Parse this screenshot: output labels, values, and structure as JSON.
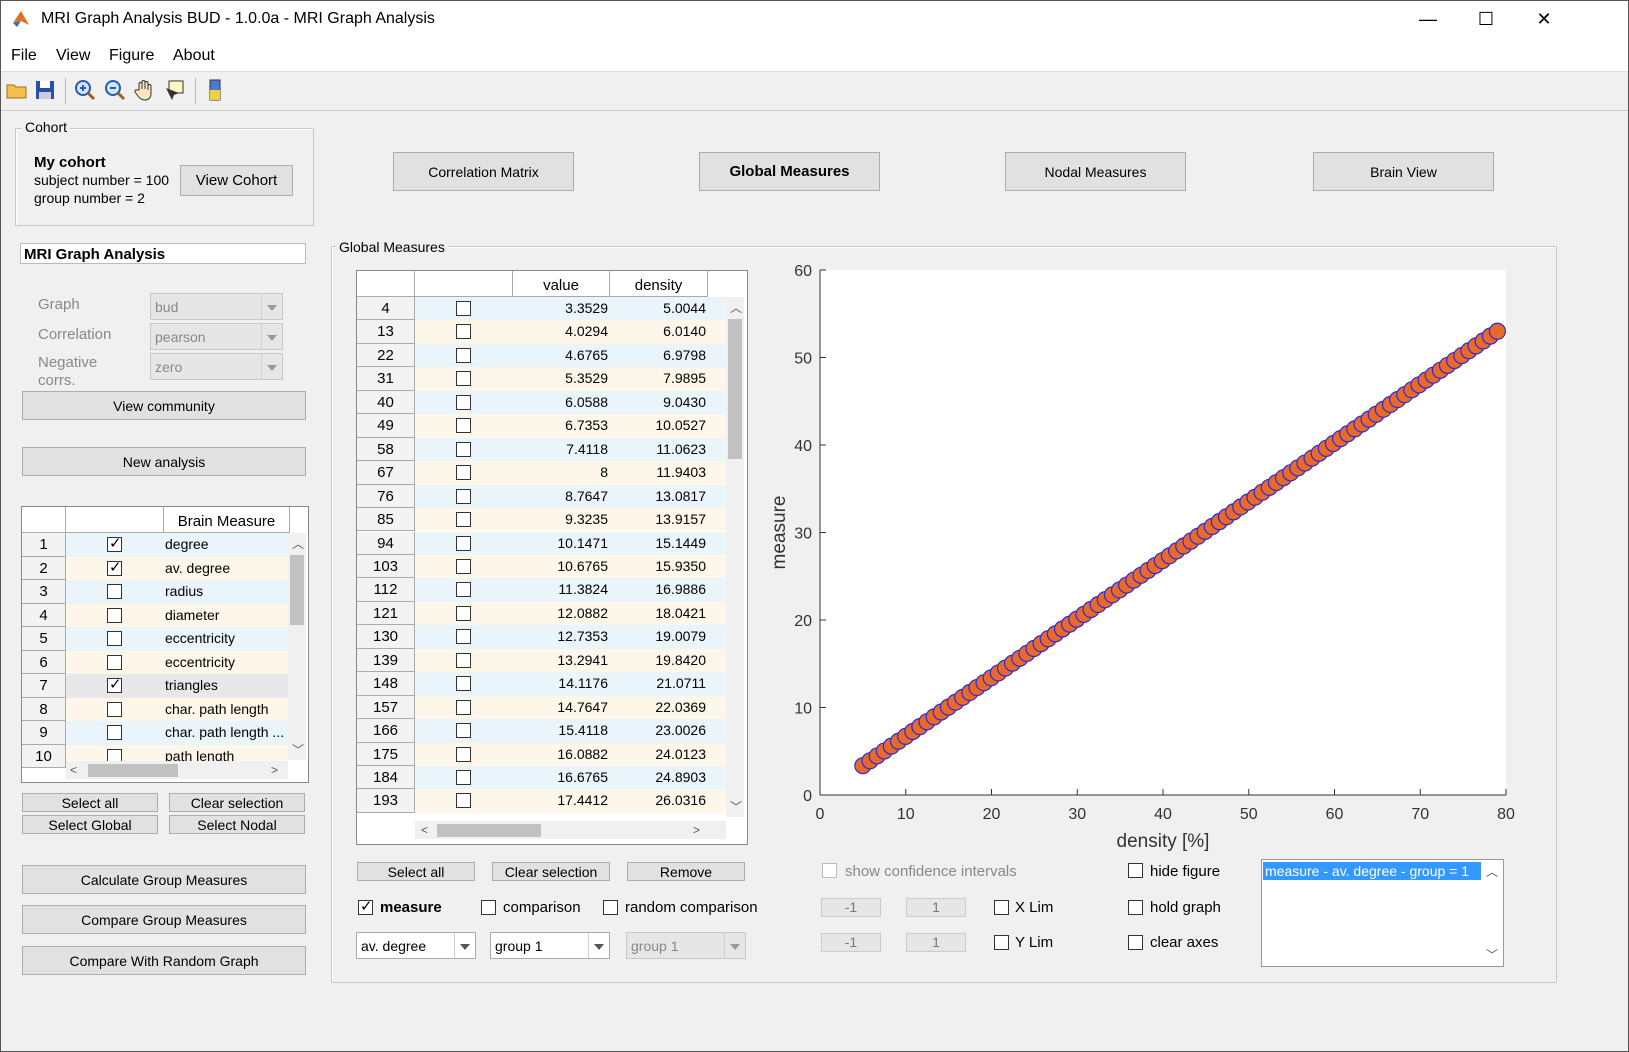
{
  "window": {
    "title": "MRI Graph Analysis BUD - 1.0.0a - MRI Graph Analysis",
    "minimize": "—",
    "maximize": "☐",
    "close": "✕"
  },
  "menu": [
    "File",
    "View",
    "Figure",
    "About"
  ],
  "toolbar": [
    "open-icon",
    "save-icon",
    "zoom-in-icon",
    "zoom-out-icon",
    "pan-icon",
    "data-cursor-icon",
    "colorbar-icon"
  ],
  "cohort": {
    "panel_title": "Cohort",
    "name": "My cohort",
    "subject_number": "subject number = 100",
    "group_number": "group number = 2",
    "view_button": "View Cohort"
  },
  "tabs": {
    "correlation": "Correlation Matrix",
    "global": "Global Measures",
    "nodal": "Nodal Measures",
    "brain": "Brain View"
  },
  "analysis": {
    "title": "MRI Graph Analysis",
    "graph_label": "Graph",
    "graph_value": "bud",
    "correlation_label": "Correlation",
    "correlation_value": "pearson",
    "negative_label_1": "Negative",
    "negative_label_2": "corrs.",
    "negative_value": "zero",
    "view_community": "View community",
    "new_analysis": "New analysis"
  },
  "measures_table": {
    "header": "Brain Measure",
    "rows": [
      {
        "n": "1",
        "checked": true,
        "name": "degree"
      },
      {
        "n": "2",
        "checked": true,
        "name": "av. degree"
      },
      {
        "n": "3",
        "checked": false,
        "name": "radius"
      },
      {
        "n": "4",
        "checked": false,
        "name": "diameter"
      },
      {
        "n": "5",
        "checked": false,
        "name": "eccentricity"
      },
      {
        "n": "6",
        "checked": false,
        "name": "eccentricity"
      },
      {
        "n": "7",
        "checked": true,
        "name": "triangles"
      },
      {
        "n": "8",
        "checked": false,
        "name": "char. path length"
      },
      {
        "n": "9",
        "checked": false,
        "name": "char. path length ..."
      },
      {
        "n": "10",
        "checked": false,
        "name": "path length"
      }
    ]
  },
  "left_buttons": {
    "select_all": "Select all",
    "clear_selection": "Clear selection",
    "select_global": "Select Global",
    "select_nodal": "Select Nodal",
    "calculate": "Calculate Group Measures",
    "compare": "Compare Group Measures",
    "compare_random": "Compare With Random Graph"
  },
  "global_panel": {
    "title": "Global Measures",
    "col_value": "value",
    "col_density": "density",
    "rows": [
      [
        "4",
        "3.3529",
        "5.0044"
      ],
      [
        "13",
        "4.0294",
        "6.0140"
      ],
      [
        "22",
        "4.6765",
        "6.9798"
      ],
      [
        "31",
        "5.3529",
        "7.9895"
      ],
      [
        "40",
        "6.0588",
        "9.0430"
      ],
      [
        "49",
        "6.7353",
        "10.0527"
      ],
      [
        "58",
        "7.4118",
        "11.0623"
      ],
      [
        "67",
        "8",
        "11.9403"
      ],
      [
        "76",
        "8.7647",
        "13.0817"
      ],
      [
        "85",
        "9.3235",
        "13.9157"
      ],
      [
        "94",
        "10.1471",
        "15.1449"
      ],
      [
        "103",
        "10.6765",
        "15.9350"
      ],
      [
        "112",
        "11.3824",
        "16.9886"
      ],
      [
        "121",
        "12.0882",
        "18.0421"
      ],
      [
        "130",
        "12.7353",
        "19.0079"
      ],
      [
        "139",
        "13.2941",
        "19.8420"
      ],
      [
        "148",
        "14.1176",
        "21.0711"
      ],
      [
        "157",
        "14.7647",
        "22.0369"
      ],
      [
        "166",
        "15.4118",
        "23.0026"
      ],
      [
        "175",
        "16.0882",
        "24.0123"
      ],
      [
        "184",
        "16.6765",
        "24.8903"
      ],
      [
        "193",
        "17.4412",
        "26.0316"
      ]
    ],
    "select_all": "Select all",
    "clear_selection": "Clear selection",
    "remove": "Remove",
    "measure_label": "measure",
    "comparison_label": "comparison",
    "random_label": "random comparison",
    "measure_value": "av. degree",
    "group_value": "group 1",
    "group2_value": "group 1",
    "show_ci": "show confidence intervals",
    "xlim_min": "-1",
    "xlim_max": "1",
    "xlim_label": "X Lim",
    "ylim_min": "-1",
    "ylim_max": "1",
    "ylim_label": "Y Lim",
    "hide_figure": "hide figure",
    "hold_graph": "hold graph",
    "clear_axes": "clear axes",
    "legend_item": "measure - av. degree - group = 1"
  },
  "colors": {
    "marker_fill": "#e8692a",
    "marker_edge": "#2b2bd6",
    "selection": "#3399ff"
  },
  "chart_data": {
    "type": "scatter",
    "title": "",
    "xlabel": "density [%]",
    "ylabel": "measure",
    "xlim": [
      0,
      80
    ],
    "ylim": [
      0,
      60
    ],
    "xticks": [
      "0",
      "10",
      "20",
      "30",
      "40",
      "50",
      "60",
      "70",
      "80"
    ],
    "yticks": [
      "0",
      "10",
      "20",
      "30",
      "40",
      "50",
      "60"
    ],
    "grid": false,
    "series": [
      {
        "name": "measure - av. degree - group = 1",
        "x_start": 5.0,
        "x_end": 79.0,
        "count": 90,
        "y_start": 3.35,
        "y_end": 53.0
      }
    ]
  }
}
